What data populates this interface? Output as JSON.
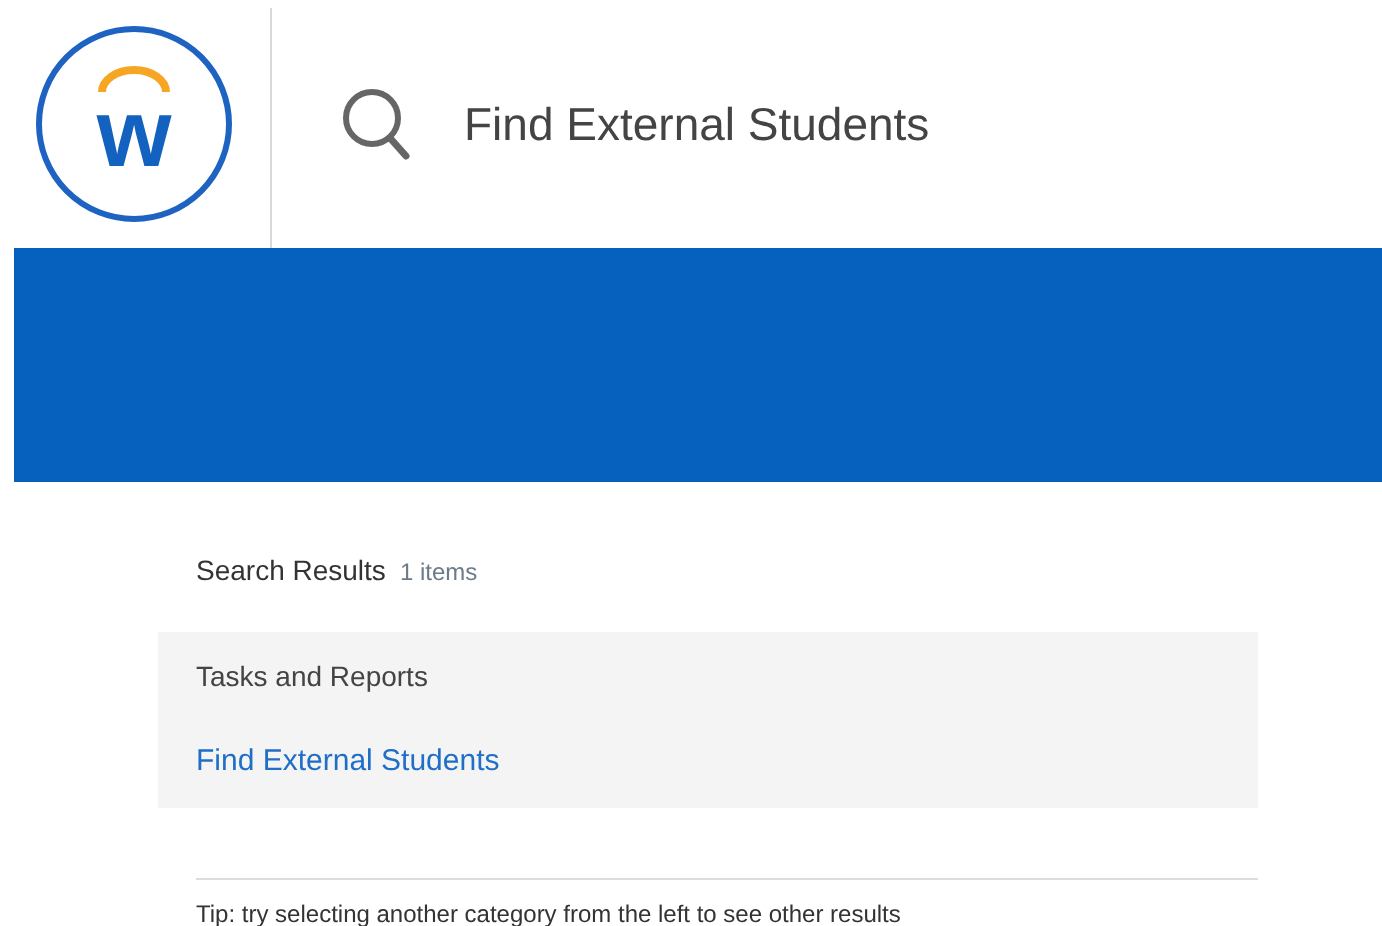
{
  "logo": {
    "letter": "w"
  },
  "search": {
    "value": "Find External Students"
  },
  "results": {
    "title": "Search Results",
    "count": "1 items",
    "groups": [
      {
        "heading": "Tasks and Reports",
        "items": [
          "Find External Students"
        ]
      }
    ]
  },
  "tip": "Tip: try selecting another category from the left to see other results"
}
